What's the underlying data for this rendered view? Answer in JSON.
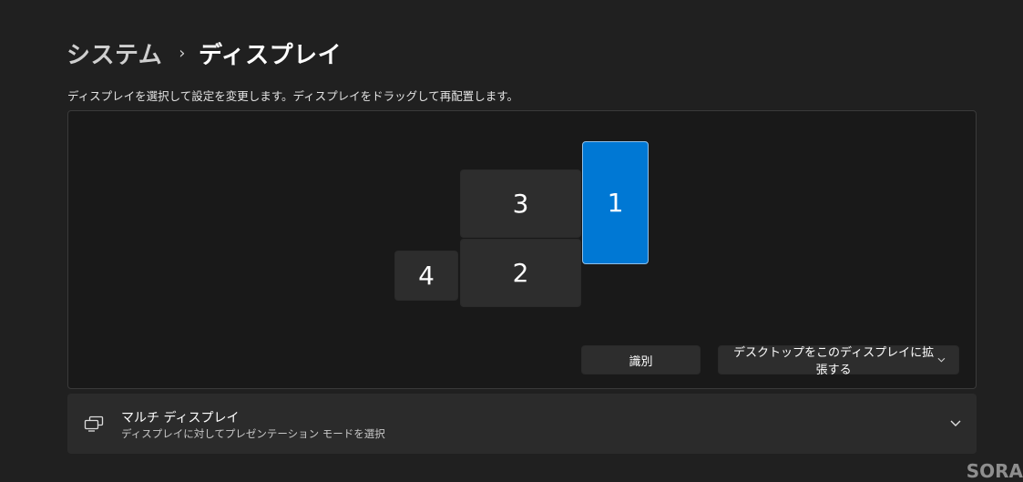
{
  "breadcrumb": {
    "parent": "システム",
    "separator": "›",
    "current": "ディスプレイ"
  },
  "instructions": "ディスプレイを選択して設定を変更します。ディスプレイをドラッグして再配置します。",
  "displays": [
    {
      "label": "1",
      "selected": true
    },
    {
      "label": "2",
      "selected": false
    },
    {
      "label": "3",
      "selected": false
    },
    {
      "label": "4",
      "selected": false
    }
  ],
  "actions": {
    "identify_label": "識別",
    "mode_dropdown": {
      "selected": "デスクトップをこのディスプレイに拡張する",
      "icon": "chevron-down-icon"
    }
  },
  "multi_display": {
    "title": "マルチ ディスプレイ",
    "subtitle": "ディスプレイに対してプレゼンテーション モードを選択",
    "icon": "multi-display-icon",
    "expand_icon": "chevron-down-icon"
  },
  "watermark": "SORA",
  "colors": {
    "background": "#202020",
    "panel": "#191919",
    "selected_display": "#0078d4",
    "display": "#2d2d2d"
  }
}
